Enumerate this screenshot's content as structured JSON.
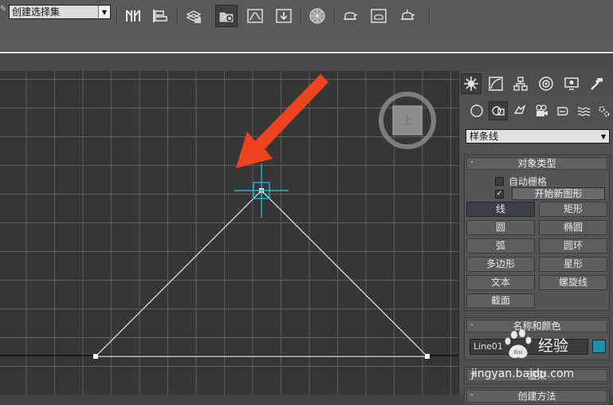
{
  "toolbar": {
    "selection_set": {
      "value": "创建选择集"
    },
    "icons": [
      "mirror-icon",
      "align-icon",
      "layer-manager-icon",
      "scene-explorer-icon",
      "curve-editor-icon",
      "schematic-view-icon",
      "material-editor-icon",
      "render-setup-icon",
      "rendered-frame-icon",
      "render-icon"
    ]
  },
  "command_panel": {
    "tabs": [
      "create-tab",
      "modify-tab",
      "hierarchy-tab",
      "motion-tab",
      "display-tab",
      "utilities-tab"
    ],
    "subcategories": [
      "geometry",
      "shapes",
      "lights",
      "cameras",
      "helpers",
      "space-warps",
      "systems"
    ],
    "category": {
      "value": "样条线"
    },
    "object_type": {
      "title": "对象类型",
      "auto_grid": {
        "label": "自动栅格",
        "checked": false
      },
      "start_new_shape": {
        "label": "开始新图形",
        "checked": true,
        "check_glyph": "✓"
      },
      "buttons": [
        {
          "label": "线",
          "active": true
        },
        {
          "label": "矩形",
          "active": false
        },
        {
          "label": "圆",
          "active": false
        },
        {
          "label": "椭圆",
          "active": false
        },
        {
          "label": "弧",
          "active": false
        },
        {
          "label": "圆环",
          "active": false
        },
        {
          "label": "多边形",
          "active": false
        },
        {
          "label": "星形",
          "active": false
        },
        {
          "label": "文本",
          "active": false
        },
        {
          "label": "螺旋线",
          "active": false
        },
        {
          "label": "截面",
          "active": false
        }
      ]
    },
    "name_and_color": {
      "title": "名称和颜色",
      "name_value": "Line01",
      "color": "#1f8fb0"
    },
    "rendering": {
      "title": "渲染",
      "prefix": "+"
    },
    "creation_method": {
      "title": "创建方法"
    }
  },
  "viewport": {
    "viewcube_label": "上",
    "grid_color": "#5e5e5e",
    "line_color": "#e8e8e8",
    "cursor_color": "#1fb7cf",
    "arrow_color": "#ee4520"
  },
  "watermark": {
    "brand": "经验",
    "url": "jingyan.baidu.com",
    "logo_text": "Bai"
  }
}
